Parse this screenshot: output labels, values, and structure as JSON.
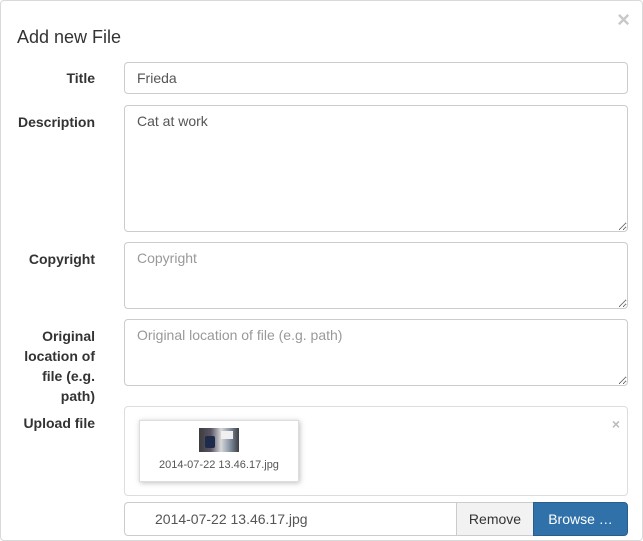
{
  "dialog": {
    "title": "Add new File",
    "close_glyph": "×"
  },
  "form": {
    "title_label": "Title",
    "title_value": "Frieda",
    "description_label": "Description",
    "description_value": "Cat at work",
    "copyright_label": "Copyright",
    "copyright_placeholder": "Copyright",
    "copyright_value": "",
    "original_location_label_lines": [
      "Original",
      "location of",
      "file (e.g.",
      "path)"
    ],
    "original_location_placeholder": "Original location of file (e.g. path)",
    "original_location_value": "",
    "upload_label": "Upload file"
  },
  "upload": {
    "preview_caption": "2014-07-22 13.46.17.jpg",
    "preview_remove_glyph": "×",
    "file_name": "2014-07-22 13.46.17.jpg",
    "remove_label": "Remove",
    "browse_label": "Browse …"
  },
  "colors": {
    "browse_button": "#3071a9",
    "border": "#cccccc"
  }
}
